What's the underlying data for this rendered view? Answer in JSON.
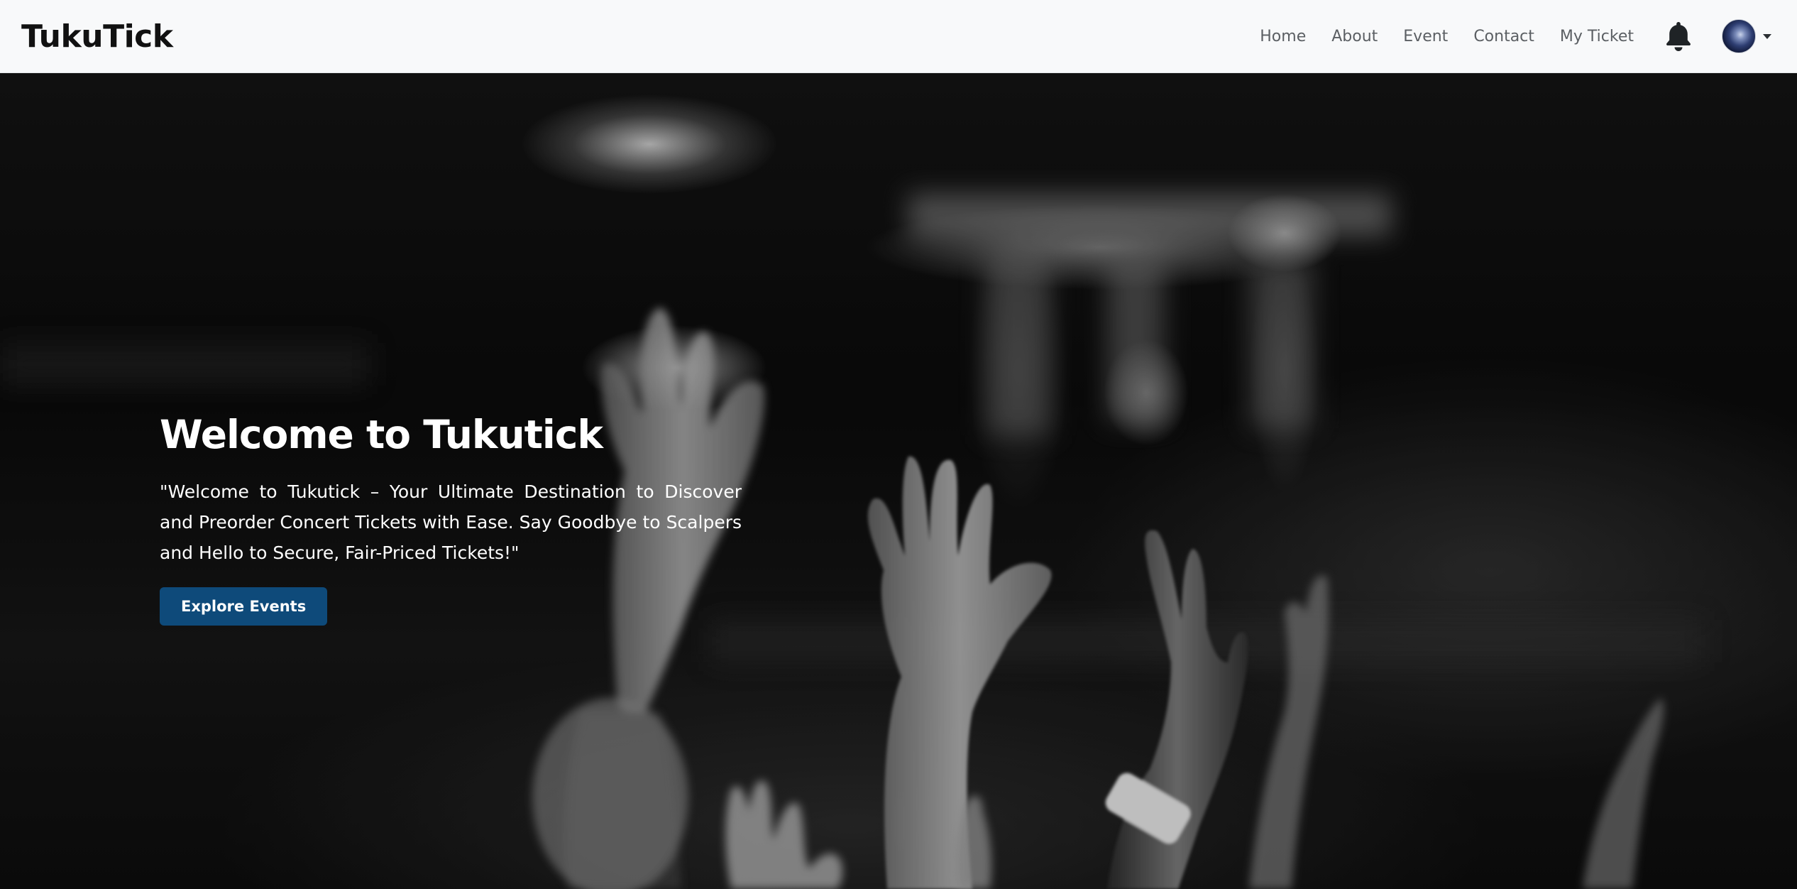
{
  "brand": {
    "name": "TukuTick"
  },
  "nav": {
    "links": [
      {
        "label": "Home"
      },
      {
        "label": "About"
      },
      {
        "label": "Event"
      },
      {
        "label": "Contact"
      },
      {
        "label": "My Ticket"
      }
    ],
    "notification_icon": "bell-icon",
    "profile_icon": "avatar"
  },
  "hero": {
    "title": "Welcome to Tukutick",
    "description": "\"Welcome to Tukutick – Your Ultimate Destination to Discover and Preorder Concert Tickets with Ease. Say Goodbye to Scalpers and Hello to Secure, Fair-Priced Tickets!\"",
    "cta_label": "Explore Events",
    "background": "black-and-white photo of concert crowd with raised hands"
  },
  "colors": {
    "navbar_bg": "#f8f9fa",
    "cta_bg": "#0e4a7a",
    "hero_text": "#ffffff"
  }
}
